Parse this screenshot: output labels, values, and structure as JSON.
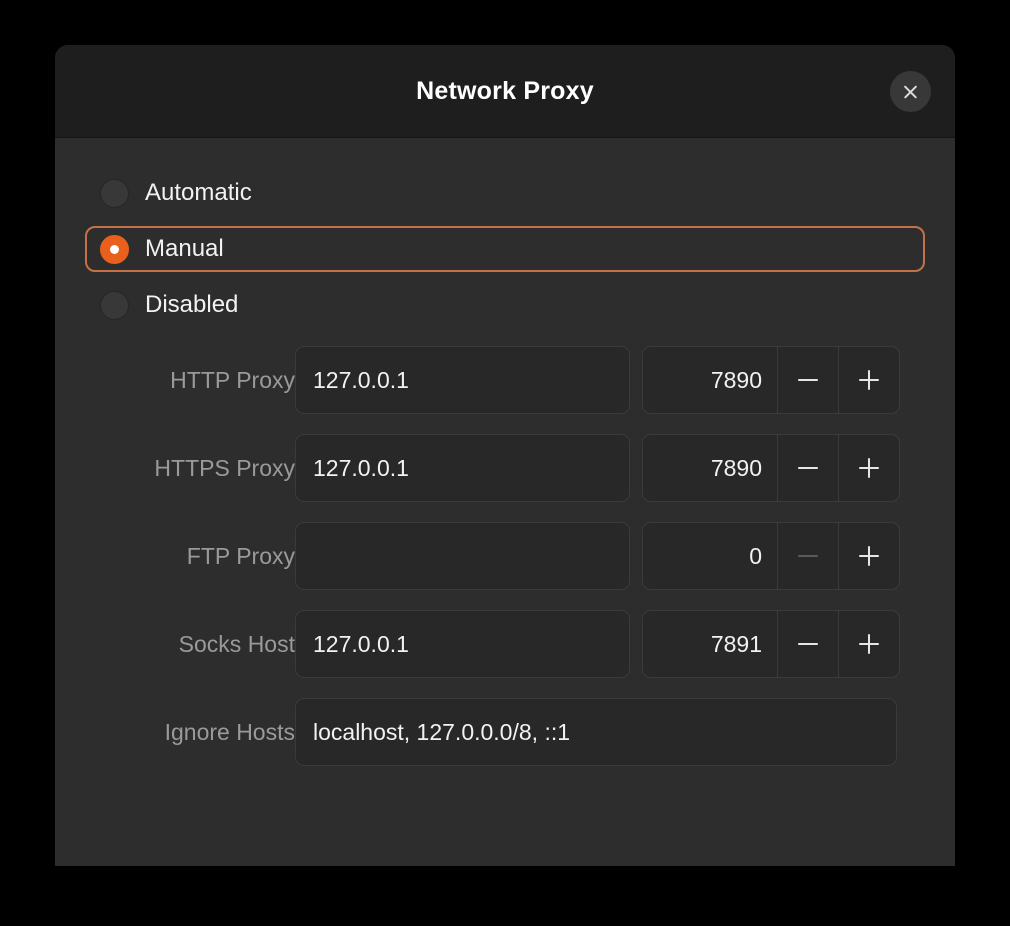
{
  "window": {
    "title": "Network Proxy",
    "close_icon": "close-icon",
    "accent_color": "#e8601c",
    "focus_border_color": "#c4714a",
    "background_color": "#2d2d2d",
    "titlebar_color": "#1e1e1e"
  },
  "proxy_mode": {
    "selected": "Manual",
    "options": [
      {
        "label": "Automatic",
        "selected": false
      },
      {
        "label": "Manual",
        "selected": true
      },
      {
        "label": "Disabled",
        "selected": false
      }
    ]
  },
  "fields": [
    {
      "label": "HTTP Proxy",
      "host": "127.0.0.1",
      "host_placeholder": "",
      "port": "7890",
      "minus_enabled": true,
      "plus_enabled": true
    },
    {
      "label": "HTTPS Proxy",
      "host": "127.0.0.1",
      "host_placeholder": "",
      "port": "7890",
      "minus_enabled": true,
      "plus_enabled": true
    },
    {
      "label": "FTP Proxy",
      "host": "",
      "host_placeholder": "",
      "port": "0",
      "minus_enabled": false,
      "plus_enabled": true
    },
    {
      "label": "Socks Host",
      "host": "127.0.0.1",
      "host_placeholder": "",
      "port": "7891",
      "minus_enabled": true,
      "plus_enabled": true
    }
  ],
  "ignore_hosts": {
    "label": "Ignore Hosts",
    "value": "localhost, 127.0.0.0/8, ::1",
    "placeholder": ""
  },
  "spinner_glyphs": {
    "minus": "minus-icon",
    "plus": "plus-icon"
  }
}
